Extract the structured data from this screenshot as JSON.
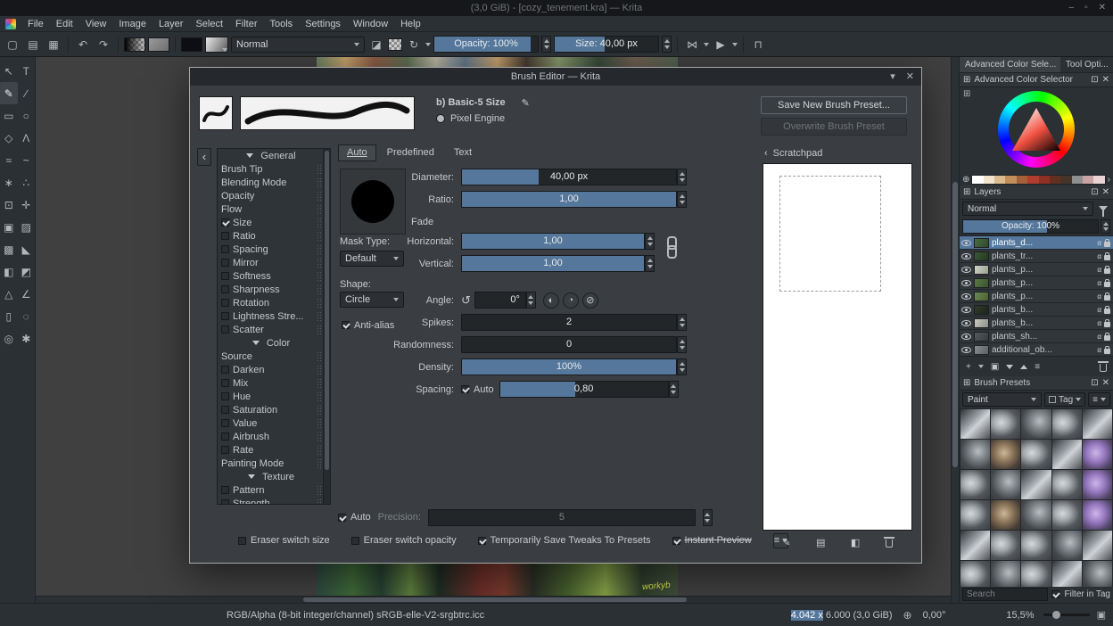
{
  "icons": {
    "minimize": "–",
    "maximize": "▫",
    "close": "✕",
    "new_doc": "▢",
    "open_doc": "▤",
    "save_doc": "▦",
    "undo": "↶",
    "redo": "↷",
    "eraser": "◪",
    "reload": "↻",
    "mirror_h": "⋈",
    "mirror_v": "▶",
    "wrap": "⊓",
    "chevron_left": "‹",
    "chevron_down": "▾",
    "edit": "✎",
    "menu": "≡",
    "alpha": "α",
    "grid": "⊞",
    "float": "⊡",
    "dial": "↺",
    "angle1": "◐",
    "angle2": "◔",
    "angle3": "⊘",
    "paint": "✎",
    "frame": "▤",
    "fill": "◧",
    "plus": "+",
    "dup": "▣",
    "props": "≡",
    "history": "⊕",
    "strip_scroll": "›",
    "crosshair": "⊕",
    "canvas_mode": "▣"
  },
  "window": {
    "title": "(3,0 GiB) - [cozy_tenement.kra] — Krita"
  },
  "menubar": {
    "items": [
      "File",
      "Edit",
      "View",
      "Image",
      "Layer",
      "Select",
      "Filter",
      "Tools",
      "Settings",
      "Window",
      "Help"
    ]
  },
  "toolbar": {
    "blending_mode": "Normal",
    "opacity": "Opacity: 100%",
    "size": "Size: 40,00 px"
  },
  "toolbox": {
    "tools": [
      {
        "name": "select-shapes",
        "glyph": "↖"
      },
      {
        "name": "text",
        "glyph": "T"
      },
      {
        "name": "freehand-brush",
        "glyph": "✎"
      },
      {
        "name": "line",
        "glyph": "∕"
      },
      {
        "name": "rectangle",
        "glyph": "▭"
      },
      {
        "name": "ellipse",
        "glyph": "○"
      },
      {
        "name": "polygon",
        "glyph": "◇"
      },
      {
        "name": "polyline",
        "glyph": "Λ"
      },
      {
        "name": "bezier-curve",
        "glyph": "≈"
      },
      {
        "name": "freehand-path",
        "glyph": "~"
      },
      {
        "name": "dynamic-brush",
        "glyph": "∗"
      },
      {
        "name": "multibrush",
        "glyph": "∴"
      },
      {
        "name": "transform",
        "glyph": "⊡"
      },
      {
        "name": "move",
        "glyph": "✛"
      },
      {
        "name": "crop",
        "glyph": "▣"
      },
      {
        "name": "gradient",
        "glyph": "▨"
      },
      {
        "name": "pattern",
        "glyph": "▩"
      },
      {
        "name": "color-sampler",
        "glyph": "◣"
      },
      {
        "name": "fill",
        "glyph": "◧"
      },
      {
        "name": "enclose-fill",
        "glyph": "◩"
      },
      {
        "name": "assistants",
        "glyph": "△"
      },
      {
        "name": "measure",
        "glyph": "∠"
      },
      {
        "name": "rect-select",
        "glyph": "▯"
      },
      {
        "name": "ellipse-select",
        "glyph": "◌"
      },
      {
        "name": "zoom",
        "glyph": "◎"
      },
      {
        "name": "pan",
        "glyph": "✱"
      }
    ]
  },
  "canvas": {
    "signature": "workyb"
  },
  "dialog": {
    "title": "Brush Editor — Krita",
    "brush_name": "b) Basic-5 Size",
    "engine": "Pixel Engine",
    "save_button": "Save New Brush Preset...",
    "overwrite_button": "Overwrite Brush Preset",
    "tabs": [
      "Auto",
      "Predefined",
      "Text"
    ],
    "options": [
      {
        "label": "General",
        "type": "header"
      },
      {
        "label": "Brush Tip"
      },
      {
        "label": "Blending Mode"
      },
      {
        "label": "Opacity"
      },
      {
        "label": "Flow"
      },
      {
        "label": "Size",
        "checkbox": true,
        "checked": true
      },
      {
        "label": "Ratio",
        "checkbox": true,
        "checked": false
      },
      {
        "label": "Spacing",
        "checkbox": true,
        "checked": false
      },
      {
        "label": "Mirror",
        "checkbox": true,
        "checked": false
      },
      {
        "label": "Softness",
        "checkbox": true,
        "checked": false
      },
      {
        "label": "Sharpness",
        "checkbox": true,
        "checked": false
      },
      {
        "label": "Rotation",
        "checkbox": true,
        "checked": false
      },
      {
        "label": "Lightness Stre...",
        "checkbox": true,
        "checked": false
      },
      {
        "label": "Scatter",
        "checkbox": true,
        "checked": false
      },
      {
        "label": "Color",
        "type": "header"
      },
      {
        "label": "Source"
      },
      {
        "label": "Darken",
        "checkbox": true,
        "checked": false
      },
      {
        "label": "Mix",
        "checkbox": true,
        "checked": false
      },
      {
        "label": "Hue",
        "checkbox": true,
        "checked": false
      },
      {
        "label": "Saturation",
        "checkbox": true,
        "checked": false
      },
      {
        "label": "Value",
        "checkbox": true,
        "checked": false
      },
      {
        "label": "Airbrush",
        "checkbox": true,
        "checked": false
      },
      {
        "label": "Rate",
        "checkbox": true,
        "checked": false
      },
      {
        "label": "Painting Mode"
      },
      {
        "label": "Texture",
        "type": "header"
      },
      {
        "label": "Pattern",
        "checkbox": true,
        "checked": false
      },
      {
        "label": "Strength",
        "checkbox": true,
        "checked": false
      }
    ],
    "settings": {
      "diameter_label": "Diameter:",
      "diameter_value": "40,00 px",
      "ratio_label": "Ratio:",
      "ratio_value": "1,00",
      "fade_label": "Fade",
      "mask_type_label": "Mask Type:",
      "mask_type_value": "Default",
      "horizontal_label": "Horizontal:",
      "horizontal_value": "1,00",
      "vertical_label": "Vertical:",
      "vertical_value": "1,00",
      "shape_label": "Shape:",
      "shape_value": "Circle",
      "angle_label": "Angle:",
      "angle_value": "0°",
      "antialias_label": "Anti-alias",
      "antialias_checked": true,
      "spikes_label": "Spikes:",
      "spikes_value": "2",
      "randomness_label": "Randomness:",
      "randomness_value": "0",
      "density_label": "Density:",
      "density_value": "100%",
      "spacing_label": "Spacing:",
      "spacing_auto_label": "Auto",
      "spacing_auto_checked": true,
      "spacing_value": "0,80",
      "auto_label": "Auto",
      "auto_checked": true,
      "precision_label": "Precision:",
      "precision_value": "5"
    },
    "scratchpad": {
      "title": "Scratchpad"
    },
    "footer": {
      "eraser_switch_size": "Eraser switch size",
      "eraser_switch_size_checked": false,
      "eraser_switch_opacity": "Eraser switch opacity",
      "eraser_switch_opacity_checked": false,
      "save_tweaks": "Temporarily Save Tweaks To Presets",
      "save_tweaks_checked": true,
      "instant_preview": "Instant Preview",
      "instant_preview_checked": true
    }
  },
  "dock": {
    "tabs": [
      "Advanced Color Sele...",
      "Tool Opti..."
    ],
    "color_selector": {
      "title": "Advanced Color Selector",
      "history": [
        "#ffffff",
        "#f2e3cd",
        "#dcbb8e",
        "#c08f5a",
        "#a3613a",
        "#b23c2e",
        "#8e3024",
        "#63301f",
        "#46342a",
        "#8f8f8f",
        "#caa4a4",
        "#e9d3d3"
      ]
    },
    "layers": {
      "title": "Layers",
      "blending": "Normal",
      "opacity": "Opacity: 100%",
      "items": [
        {
          "name": "plants_d...",
          "selected": true
        },
        {
          "name": "plants_tr...",
          "selected": false
        },
        {
          "name": "plants_p...",
          "selected": false
        },
        {
          "name": "plants_p...",
          "selected": false
        },
        {
          "name": "plants_p...",
          "selected": false
        },
        {
          "name": "plants_b...",
          "selected": false
        },
        {
          "name": "plants_b...",
          "selected": false
        },
        {
          "name": "plants_sh...",
          "selected": false
        },
        {
          "name": "additional_ob...",
          "selected": false
        }
      ]
    },
    "presets": {
      "title": "Brush Presets",
      "filter": "Paint",
      "tag_label": "Tag",
      "search_placeholder": "Search",
      "filter_in_tag": "Filter in Tag",
      "filter_in_tag_checked": true
    }
  },
  "statusbar": {
    "color_profile": "RGB/Alpha (8-bit integer/channel)  sRGB-elle-V2-srgbtrc.icc",
    "dims_highlight": "4.042 x",
    "dims_rest": " 6.000 (3,0 GiB)",
    "angle": "0,00°",
    "zoom": "15,5%"
  }
}
